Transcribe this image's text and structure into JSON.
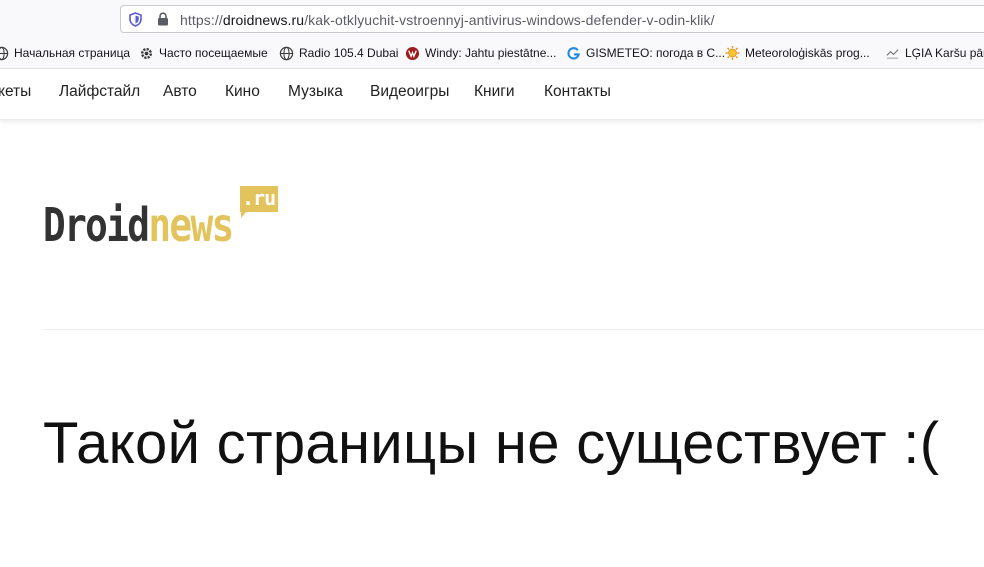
{
  "browser": {
    "url": {
      "scheme": "https://",
      "domain": "droidnews.ru",
      "path": "/kak-otklyuchit-vstroennyj-antivirus-windows-defender-v-odin-klik/"
    },
    "icons": {
      "tracking": "shield-icon",
      "security": "lock-icon"
    },
    "bookmarks": [
      {
        "label": "Начальная страница",
        "icon": "globe-icon"
      },
      {
        "label": "Часто посещаемые",
        "icon": "gear-icon"
      },
      {
        "label": "Radio 105.4 Dubai",
        "icon": "globe-icon"
      },
      {
        "label": "Windy: Jahtu piestātne...",
        "icon": "windy-icon"
      },
      {
        "label": "GISMETEO: погода в С...",
        "icon": "gismeteo-icon"
      },
      {
        "label": "Meteoroloģiskās prog...",
        "icon": "sun-icon"
      },
      {
        "label": "LĢIA Karšu pārlū",
        "icon": "map-icon"
      }
    ]
  },
  "site": {
    "nav": [
      "кеты",
      "Лайфстайл",
      "Авто",
      "Кино",
      "Музыка",
      "Видеоигры",
      "Книги",
      "Контакты"
    ],
    "logo": {
      "part1": "Droid",
      "part2": "news",
      "tld": ".ru"
    },
    "heading": "Такой страницы не существует :("
  },
  "colors": {
    "accent": "#e3c35b",
    "logo_dark": "#333333",
    "text": "#111111"
  }
}
